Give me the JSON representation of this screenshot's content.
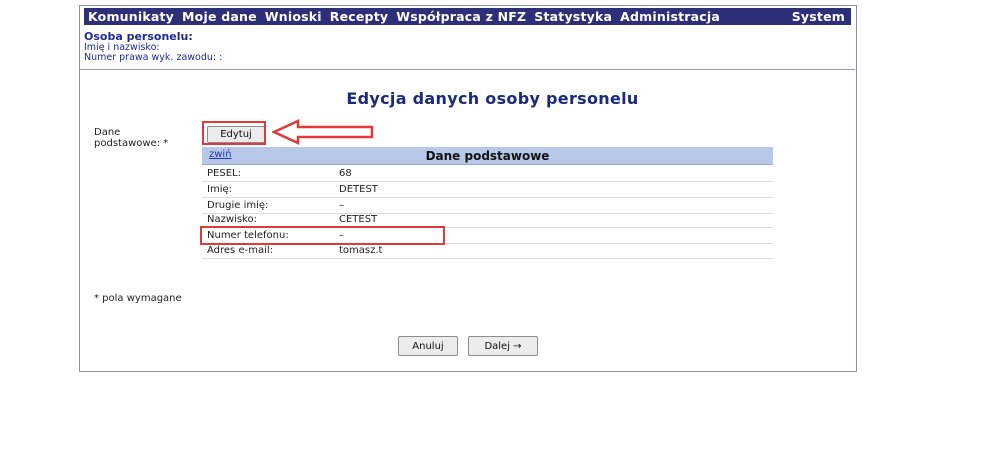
{
  "menu": {
    "items": [
      "Komunikaty",
      "Moje dane",
      "Wnioski",
      "Recepty",
      "Współpraca z NFZ",
      "Statystyka",
      "Administracja"
    ],
    "system": "System"
  },
  "person": {
    "title": "Osoba personelu:",
    "name_label": "Imię i nazwisko:",
    "license_label": "Numer prawa wyk. zawodu: :"
  },
  "page_title": "Edycja danych osoby personelu",
  "form": {
    "section_label_line1": "Dane",
    "section_label_line2": "podstawowe: *",
    "edit_button": "Edytuj"
  },
  "section": {
    "collapse_link": "zwiń",
    "title": "Dane podstawowe",
    "rows": [
      {
        "label": "PESEL:",
        "value": "68"
      },
      {
        "label": "Imię:",
        "value": "DETEST"
      },
      {
        "label": "Drugie imię:",
        "value": "–"
      },
      {
        "label": "Nazwisko:",
        "value": "CETEST"
      },
      {
        "label": "Numer telefonu:",
        "value": "–"
      },
      {
        "label": "Adres e-mail:",
        "value": "tomasz.t"
      }
    ]
  },
  "required_note": "* pola wymagane",
  "buttons": {
    "cancel": "Anuluj",
    "next": "Dalej →"
  },
  "colors": {
    "menu_bg": "#2e2f79",
    "title_blue": "#1b2a7a",
    "section_header_bg": "#b7c8e8",
    "highlight_red": "#e23a3a"
  },
  "icons": {
    "callout": "left-arrow-icon"
  }
}
